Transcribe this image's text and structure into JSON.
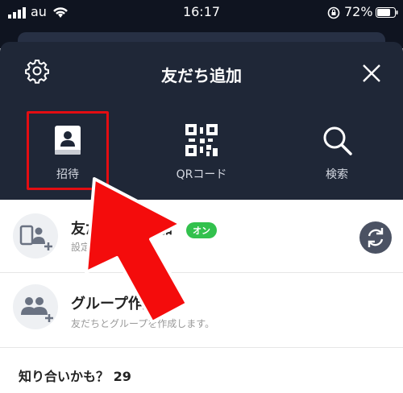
{
  "status_bar": {
    "carrier": "au",
    "time": "16:17",
    "battery": "72%"
  },
  "header": {
    "title": "友だち追加"
  },
  "actions": [
    {
      "label": "招待"
    },
    {
      "label": "QRコード"
    },
    {
      "label": "検索"
    }
  ],
  "rows": [
    {
      "title": "友だち自動追加",
      "subtitle": "設定",
      "badge": "オン"
    },
    {
      "title": "グループ作成",
      "subtitle": "友だちとグループを作成します。"
    }
  ],
  "suggestions": {
    "heading": "知り合いかも？ 29"
  },
  "colors": {
    "header_bg": "#1f2737",
    "highlight_red": "#e30d12",
    "badge_green": "#32c14d"
  }
}
